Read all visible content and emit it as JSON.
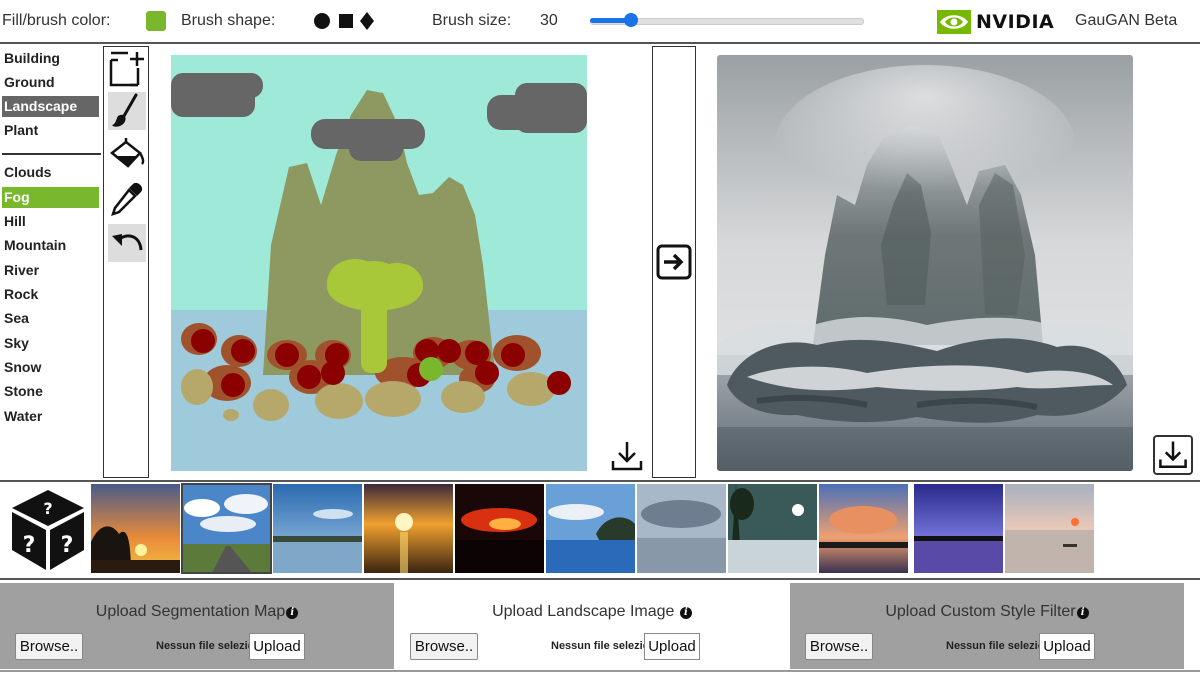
{
  "toolbar": {
    "fill_label": "Fill/brush color:",
    "fill_color": "#79b82c",
    "shape_label": "Brush shape:",
    "shapes": [
      "circle-icon",
      "square-icon",
      "diamond-icon"
    ],
    "size_label": "Brush size:",
    "size_value": "30",
    "slider_fraction": 0.15,
    "brand": "NVIDIA",
    "app_title": "GauGAN Beta"
  },
  "labels": {
    "selected_bg": "#666666",
    "active_bg": "#79b82c",
    "group1": [
      "Building",
      "Ground",
      "Landscape",
      "Plant"
    ],
    "group2": [
      "Clouds",
      "Fog",
      "Hill",
      "Mountain",
      "River",
      "Rock",
      "Sea",
      "Sky",
      "Snow",
      "Stone",
      "Water"
    ],
    "selected_group": "Landscape",
    "selected_label": "Fog"
  },
  "tools": [
    "new-canvas-icon",
    "brush-icon",
    "paint-bucket-icon",
    "eyedropper-icon",
    "undo-icon"
  ],
  "colors": {
    "sky": "#9ee9d8",
    "sea": "#9fcadb",
    "mountain": "#8d9960",
    "plant": "#a8c83a",
    "cloud": "#666666",
    "rock": "#a0522d",
    "stone": "#b5a86a",
    "fruit": "#8b0000"
  },
  "upload": [
    {
      "title": "Upload Segmentation Map",
      "browse": "Browse..",
      "nofile": "Nessun file selezionato",
      "upload": "Upload"
    },
    {
      "title": "Upload Landscape Image",
      "browse": "Browse..",
      "nofile": "Nessun file selezionato",
      "upload": "Upload"
    },
    {
      "title": "Upload Custom Style Filter",
      "browse": "Browse..",
      "nofile": "Nessun file selezionato",
      "upload": "Upload"
    }
  ],
  "gallery_count": 11,
  "gallery_selected": 1
}
